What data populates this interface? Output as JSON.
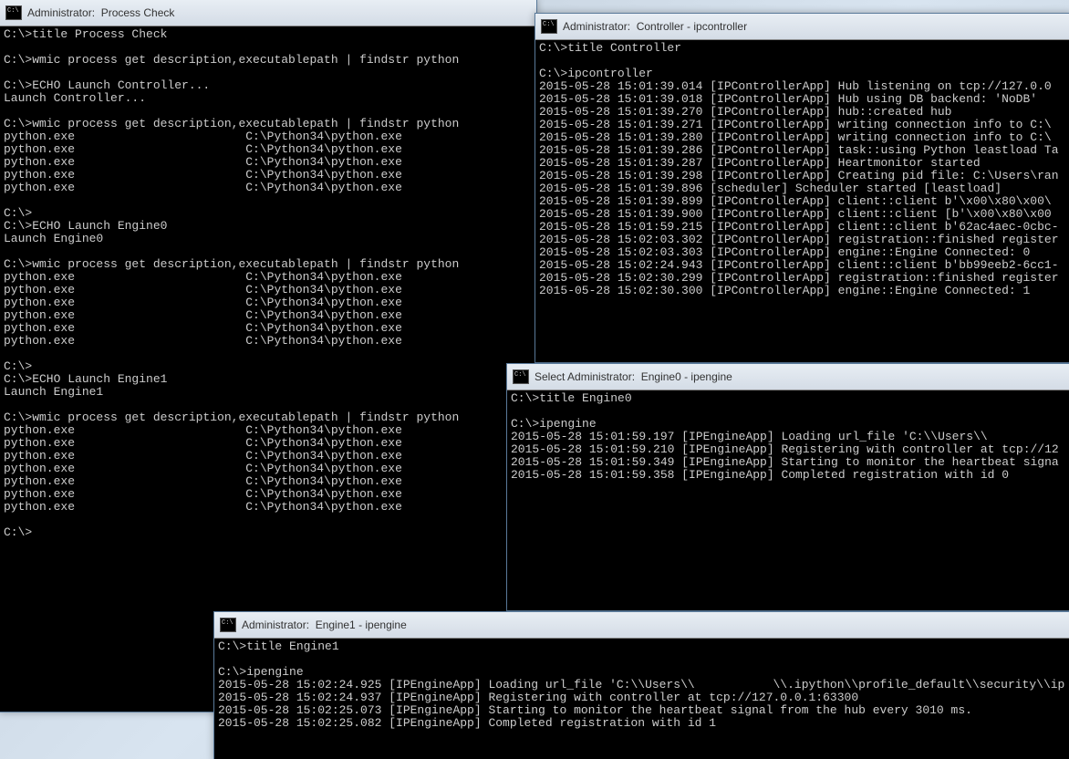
{
  "windows": {
    "process_check": {
      "title": "Administrator:  Process Check",
      "lines": [
        "C:\\>title Process Check",
        "",
        "C:\\>wmic process get description,executablepath | findstr python",
        "",
        "C:\\>ECHO Launch Controller...",
        "Launch Controller...",
        "",
        "C:\\>wmic process get description,executablepath | findstr python",
        "python.exe                        C:\\Python34\\python.exe",
        "python.exe                        C:\\Python34\\python.exe",
        "python.exe                        C:\\Python34\\python.exe",
        "python.exe                        C:\\Python34\\python.exe",
        "python.exe                        C:\\Python34\\python.exe",
        "",
        "C:\\>",
        "C:\\>ECHO Launch Engine0",
        "Launch Engine0",
        "",
        "C:\\>wmic process get description,executablepath | findstr python",
        "python.exe                        C:\\Python34\\python.exe",
        "python.exe                        C:\\Python34\\python.exe",
        "python.exe                        C:\\Python34\\python.exe",
        "python.exe                        C:\\Python34\\python.exe",
        "python.exe                        C:\\Python34\\python.exe",
        "python.exe                        C:\\Python34\\python.exe",
        "",
        "C:\\>",
        "C:\\>ECHO Launch Engine1",
        "Launch Engine1",
        "",
        "C:\\>wmic process get description,executablepath | findstr python",
        "python.exe                        C:\\Python34\\python.exe",
        "python.exe                        C:\\Python34\\python.exe",
        "python.exe                        C:\\Python34\\python.exe",
        "python.exe                        C:\\Python34\\python.exe",
        "python.exe                        C:\\Python34\\python.exe",
        "python.exe                        C:\\Python34\\python.exe",
        "python.exe                        C:\\Python34\\python.exe",
        "",
        "C:\\>"
      ]
    },
    "controller": {
      "title": "Administrator:  Controller - ipcontroller",
      "lines": [
        "C:\\>title Controller",
        "",
        "C:\\>ipcontroller",
        "2015-05-28 15:01:39.014 [IPControllerApp] Hub listening on tcp://127.0.0",
        "2015-05-28 15:01:39.018 [IPControllerApp] Hub using DB backend: 'NoDB'",
        "2015-05-28 15:01:39.270 [IPControllerApp] hub::created hub",
        "2015-05-28 15:01:39.271 [IPControllerApp] writing connection info to C:\\",
        "2015-05-28 15:01:39.280 [IPControllerApp] writing connection info to C:\\",
        "2015-05-28 15:01:39.286 [IPControllerApp] task::using Python leastload Ta",
        "2015-05-28 15:01:39.287 [IPControllerApp] Heartmonitor started",
        "2015-05-28 15:01:39.298 [IPControllerApp] Creating pid file: C:\\Users\\ran",
        "2015-05-28 15:01:39.896 [scheduler] Scheduler started [leastload]",
        "2015-05-28 15:01:39.899 [IPControllerApp] client::client b'\\x00\\x80\\x00\\",
        "2015-05-28 15:01:39.900 [IPControllerApp] client::client [b'\\x00\\x80\\x00",
        "2015-05-28 15:01:59.215 [IPControllerApp] client::client b'62ac4aec-0cbc-",
        "2015-05-28 15:02:03.302 [IPControllerApp] registration::finished register",
        "2015-05-28 15:02:03.303 [IPControllerApp] engine::Engine Connected: 0",
        "2015-05-28 15:02:24.943 [IPControllerApp] client::client b'bb99eeb2-6cc1-",
        "2015-05-28 15:02:30.299 [IPControllerApp] registration::finished register",
        "2015-05-28 15:02:30.300 [IPControllerApp] engine::Engine Connected: 1"
      ]
    },
    "engine0": {
      "title": "Select Administrator:  Engine0 - ipengine",
      "lines": [
        "C:\\>title Engine0",
        "",
        "C:\\>ipengine",
        "2015-05-28 15:01:59.197 [IPEngineApp] Loading url_file 'C:\\\\Users\\\\              \\",
        "2015-05-28 15:01:59.210 [IPEngineApp] Registering with controller at tcp://12",
        "2015-05-28 15:01:59.349 [IPEngineApp] Starting to monitor the heartbeat signa",
        "2015-05-28 15:01:59.358 [IPEngineApp] Completed registration with id 0"
      ]
    },
    "engine1": {
      "title": "Administrator:  Engine1 - ipengine",
      "lines": [
        "C:\\>title Engine1",
        "",
        "C:\\>ipengine",
        "2015-05-28 15:02:24.925 [IPEngineApp] Loading url_file 'C:\\\\Users\\\\           \\\\.ipython\\\\profile_default\\\\security\\\\ip",
        "2015-05-28 15:02:24.937 [IPEngineApp] Registering with controller at tcp://127.0.0.1:63300",
        "2015-05-28 15:02:25.073 [IPEngineApp] Starting to monitor the heartbeat signal from the hub every 3010 ms.",
        "2015-05-28 15:02:25.082 [IPEngineApp] Completed registration with id 1"
      ]
    }
  }
}
